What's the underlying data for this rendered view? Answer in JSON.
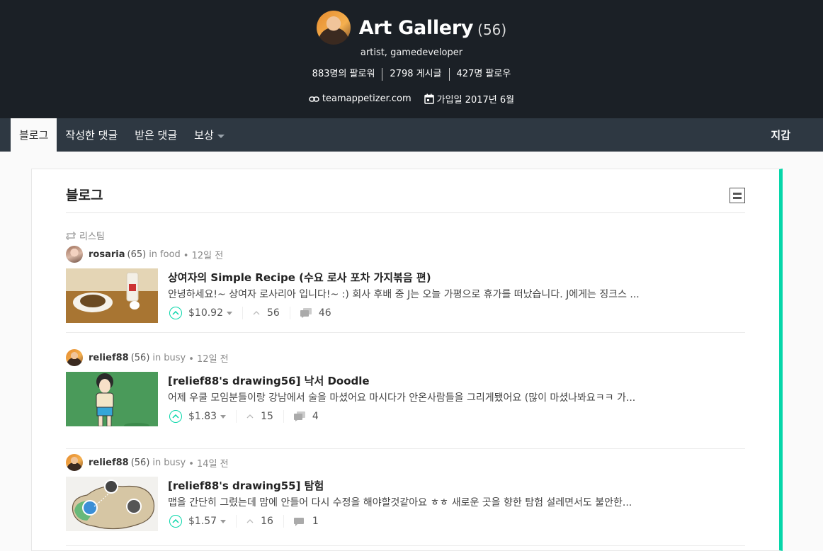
{
  "header": {
    "title": "Art Gallery",
    "reputation": "(56)",
    "about": "artist, gamedeveloper",
    "stats": {
      "followers": "883명의 팔로워",
      "posts": "2798 게시글",
      "following": "427명 팔로우"
    },
    "website": "teamappetizer.com",
    "joined": "가입일 2017년 6월"
  },
  "nav": {
    "tabs": [
      {
        "label": "블로그"
      },
      {
        "label": "작성한 댓글"
      },
      {
        "label": "받은 댓글"
      },
      {
        "label": "보상"
      }
    ],
    "wallet": "지갑"
  },
  "main": {
    "title": "블로그",
    "posts": [
      {
        "resteem_label": "리스팀",
        "author": "rosaria",
        "rep": "(65)",
        "in_label": "in",
        "category": "food",
        "time": "• 12일 전",
        "title": "상여자의 Simple Recipe (수요 로사 포차 가지볶음 편)",
        "body": "안녕하세요!~ 상여자 로사리아 입니다!~ :) 회사 후배 중 J는 오늘 가평으로 휴가를 떠났습니다. J에게는 징크스 ...",
        "payout": "$10.92",
        "votes": "56",
        "comments": "46"
      },
      {
        "author": "relief88",
        "rep": "(56)",
        "in_label": "in",
        "category": "busy",
        "time": "• 12일 전",
        "title": "[relief88's drawing56] 낙서 Doodle",
        "body": "어제 우쿨 모임분들이랑 강남에서 술을 마셨어요 마시다가 안온사람들을 그리게됐어요 (많이 마셨나봐요ㅋㅋ 가...",
        "payout": "$1.83",
        "votes": "15",
        "comments": "4"
      },
      {
        "author": "relief88",
        "rep": "(56)",
        "in_label": "in",
        "category": "busy",
        "time": "• 14일 전",
        "title": "[relief88's drawing55] 탐험",
        "body": "맵을 간단히 그렸는데 맘에 안들어 다시 수정을 해야할것같아요 ㅎㅎ 새로운 곳을 향한 탐험 설레면서도 불안한...",
        "payout": "$1.57",
        "votes": "16",
        "comments": "1"
      }
    ]
  },
  "colors": {
    "header_bg": "#1b2026",
    "nav_bg": "#2e3842",
    "accent": "#06d6a9"
  }
}
